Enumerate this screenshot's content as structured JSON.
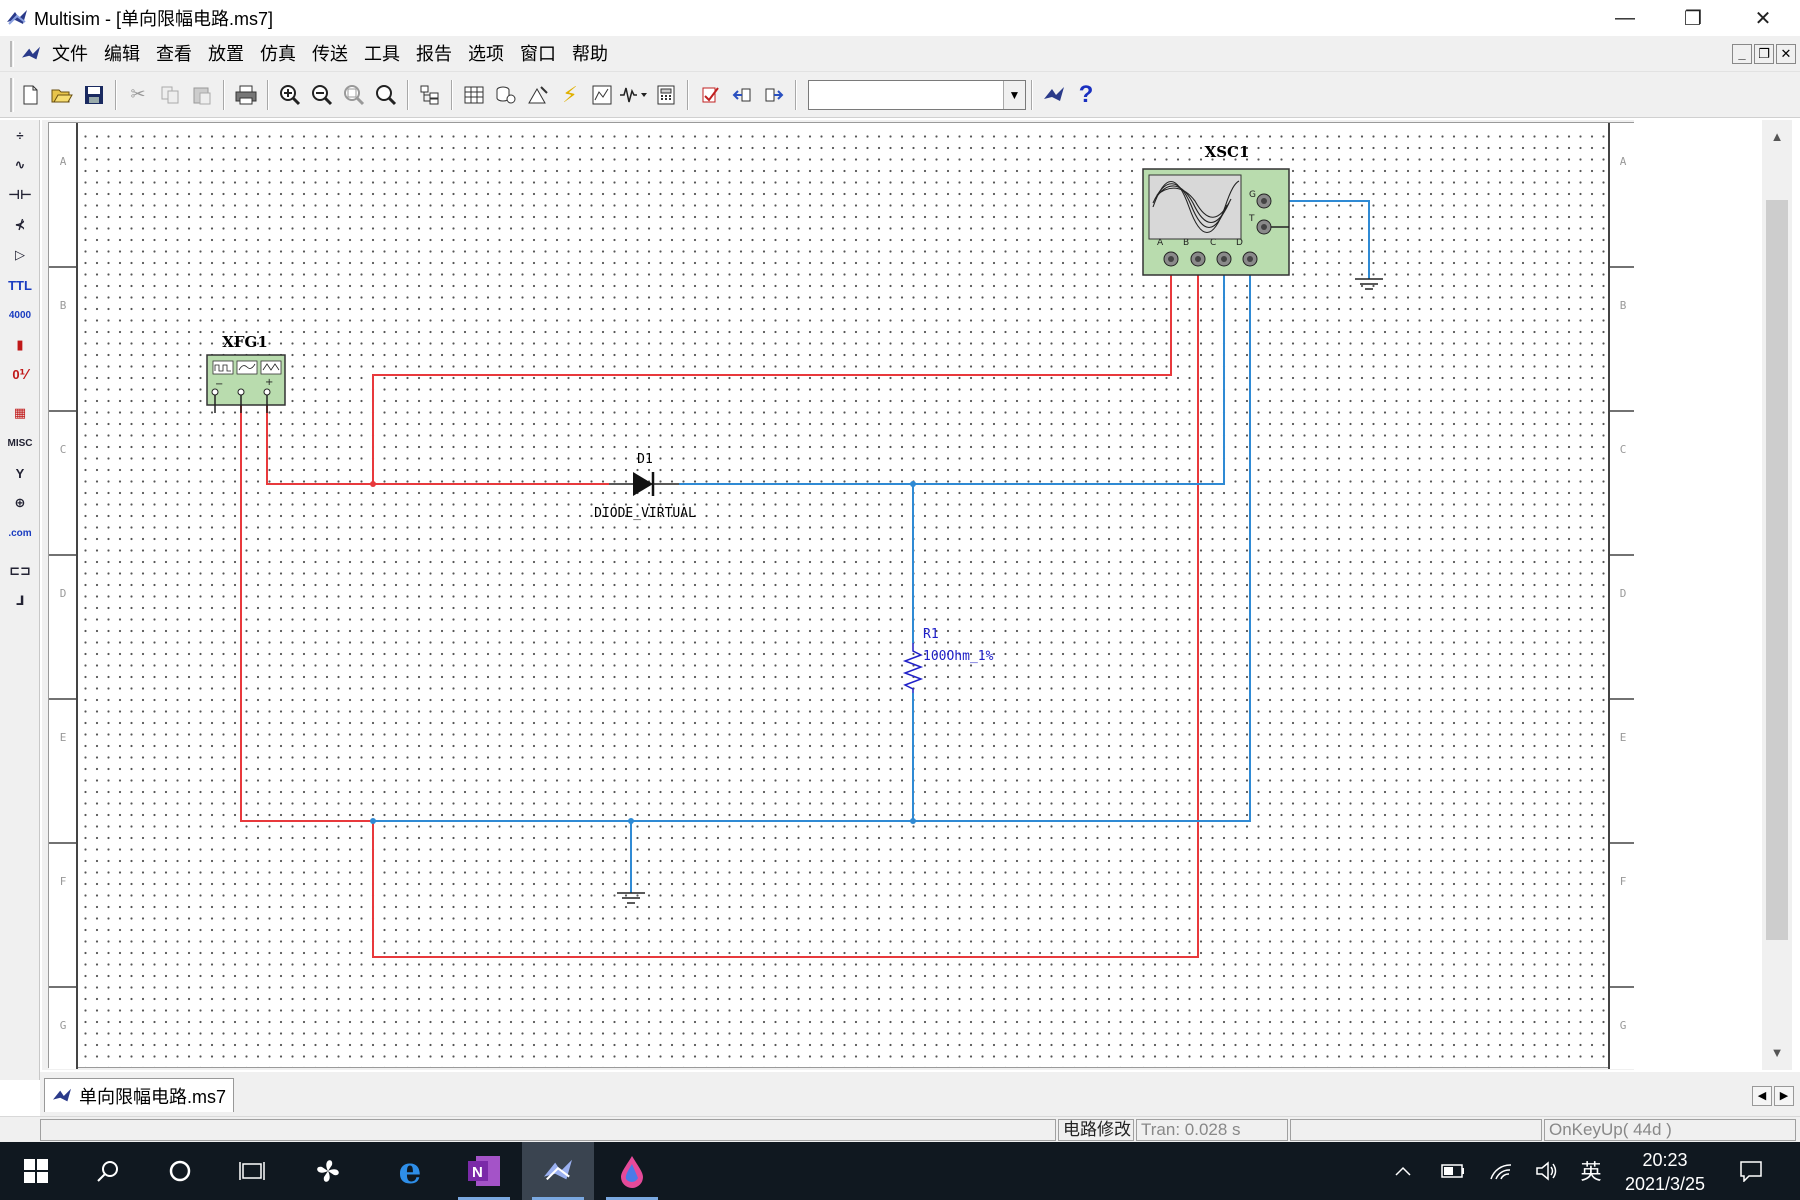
{
  "window": {
    "title": "Multisim - [单向限幅电路.ms7]",
    "minimize_glyph": "—",
    "restore_glyph": "❐",
    "close_glyph": "✕"
  },
  "menu": {
    "items": [
      "文件",
      "编辑",
      "查看",
      "放置",
      "仿真",
      "传送",
      "工具",
      "报告",
      "选项",
      "窗口",
      "帮助"
    ],
    "mdi_minimize": "_",
    "mdi_restore": "❐",
    "mdi_close": "✕"
  },
  "toolbar": {
    "icons": [
      "new-icon",
      "open-icon",
      "save-icon",
      "cut-icon",
      "copy-icon",
      "paste-icon",
      "print-icon",
      "zoom-in-icon",
      "zoom-out-icon",
      "zoom-area-icon",
      "zoom-fit-icon",
      "hierarchy-icon",
      "spreadsheet-icon",
      "database-icon",
      "component-wizard-icon",
      "simulate-icon",
      "grapher-icon",
      "analysis-icon",
      "postprocessor-icon",
      "erc-icon",
      "back-annotate-icon",
      "forward-annotate-icon",
      "in-use-list-icon",
      "help-icon"
    ],
    "combo_value": "",
    "help_glyph": "?"
  },
  "left_toolbar": {
    "buttons": [
      {
        "name": "source-parts-icon",
        "glyph": "÷",
        "color": "normal"
      },
      {
        "name": "basic-parts-icon",
        "glyph": "∿",
        "color": "normal"
      },
      {
        "name": "diode-parts-icon",
        "glyph": "⊣⊢",
        "color": "normal"
      },
      {
        "name": "transistor-parts-icon",
        "glyph": "⊀",
        "color": "normal"
      },
      {
        "name": "analog-parts-icon",
        "glyph": "▷",
        "color": "normal"
      },
      {
        "name": "ttl-parts-icon",
        "glyph": "TTL",
        "color": "blue"
      },
      {
        "name": "cmos-parts-icon",
        "glyph": "4000",
        "color": "blue"
      },
      {
        "name": "misc-digital-parts-icon",
        "glyph": "▮",
        "color": "red"
      },
      {
        "name": "mixed-parts-icon",
        "glyph": "0⅟",
        "color": "red"
      },
      {
        "name": "indicator-parts-icon",
        "glyph": "▦",
        "color": "red"
      },
      {
        "name": "misc-parts-icon",
        "glyph": "MISC",
        "color": "normal"
      },
      {
        "name": "rf-parts-icon",
        "glyph": "Y",
        "color": "normal"
      },
      {
        "name": "electromechanical-parts-icon",
        "glyph": "⊕",
        "color": "normal"
      },
      {
        "name": "edaparts-com-icon",
        "glyph": ".com",
        "color": "blue"
      },
      {
        "name": "hierarchical-block-icon",
        "glyph": "⊏⊐",
        "color": "normal"
      },
      {
        "name": "bus-icon",
        "glyph": "⅃",
        "color": "normal"
      }
    ]
  },
  "schematic": {
    "border_rows": [
      "A",
      "B",
      "C",
      "D",
      "E",
      "F",
      "G"
    ],
    "colors": {
      "red_wire": "#e8393c",
      "blue_wire": "#2f8ad4",
      "instrument_fill": "#b9dcae",
      "component_label": "#2020c8"
    },
    "xfg1": {
      "label": "XFG1"
    },
    "xsc1": {
      "label": "XSC1",
      "channel_labels": [
        "A",
        "B",
        "C",
        "D"
      ],
      "g_label": "G",
      "t_label": "T"
    },
    "d1": {
      "label": "D1",
      "value": "DIODE_VIRTUAL"
    },
    "r1": {
      "label": "R1",
      "value": "100Ohm_1%"
    }
  },
  "doc_tab": {
    "label": "单向限幅电路.ms7"
  },
  "status": {
    "cell1": "电路修改",
    "cell2": "Tran: 0.028 s",
    "cell3": "",
    "cell4": "OnKeyUp( 44d )"
  },
  "taskbar": {
    "time": "20:23",
    "date": "2021/3/25",
    "ime": "英"
  }
}
